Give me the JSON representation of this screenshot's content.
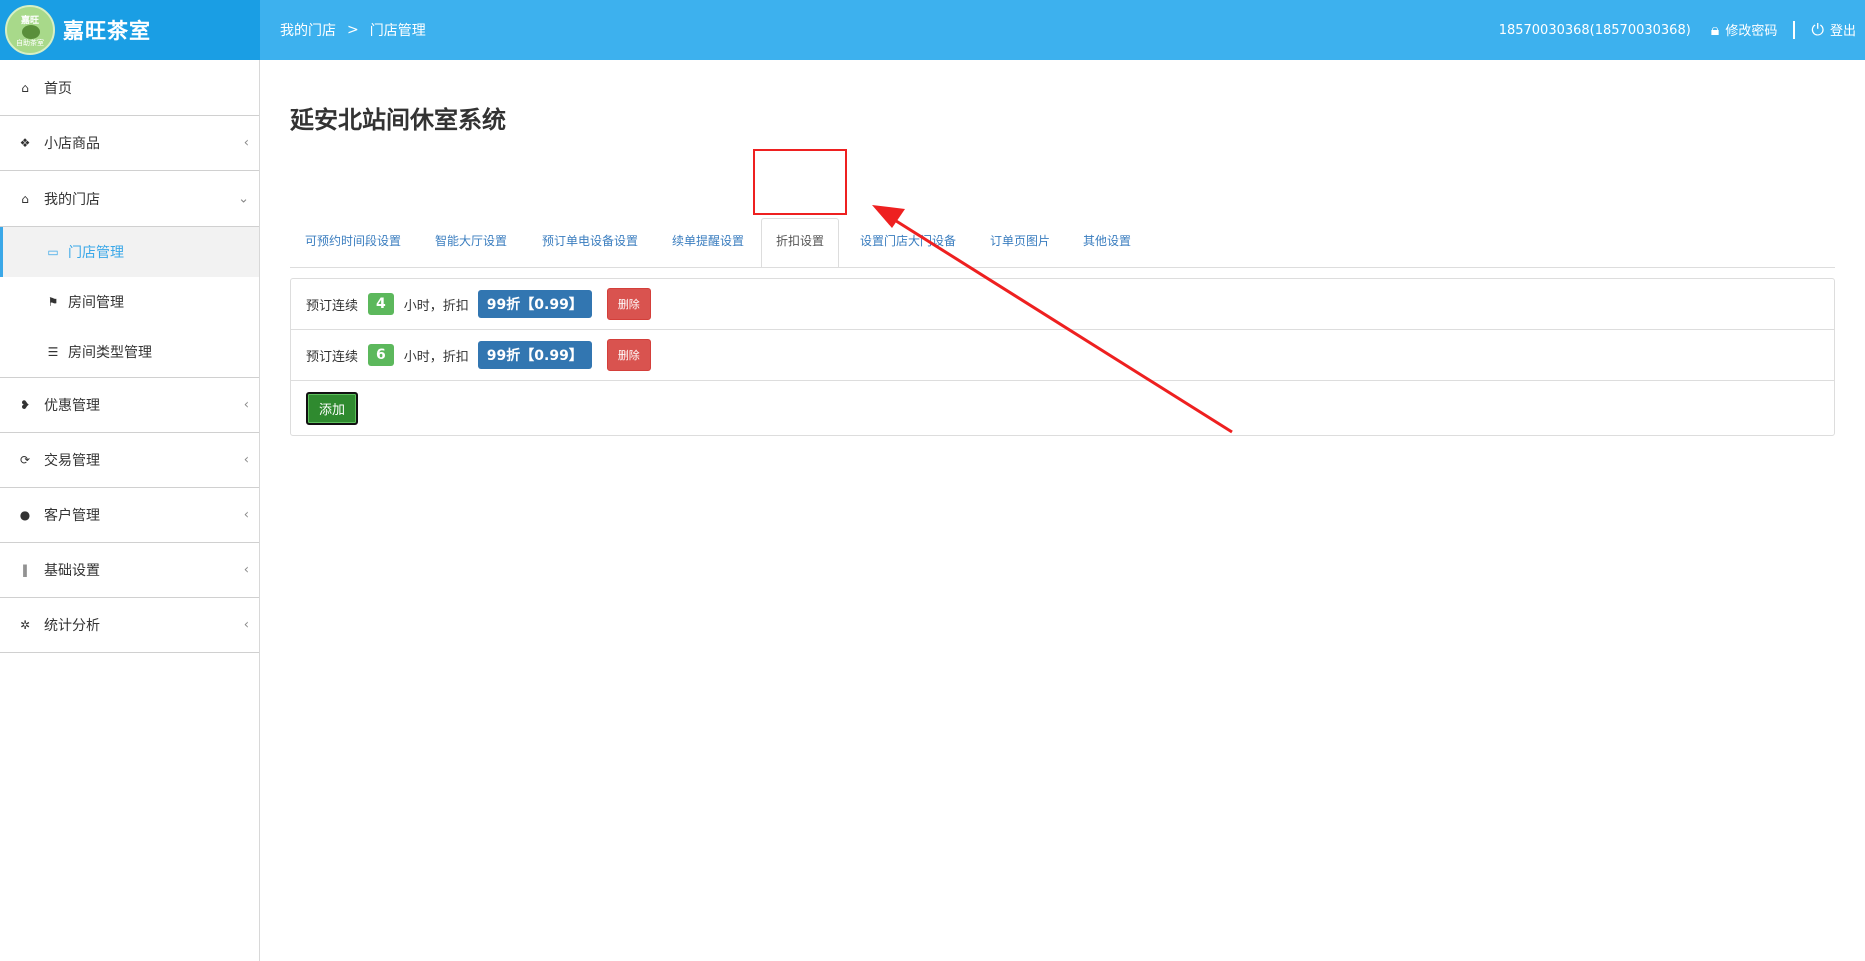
{
  "header": {
    "brand_name": "嘉旺茶室",
    "logo_text_top": "嘉旺",
    "logo_text_bottom": "自助茶室",
    "breadcrumb": [
      "我的门店",
      "门店管理"
    ],
    "breadcrumb_sep": ">",
    "user": "18570030368(18570030368)",
    "change_password": "修改密码",
    "logout": "登出",
    "colors": {
      "bar": "#3db1ee",
      "brand": "#1a9ee4"
    }
  },
  "sidebar": {
    "items": [
      {
        "label": "首页",
        "icon": "home-icon",
        "glyph": "⌂"
      },
      {
        "label": "小店商品",
        "icon": "gift-icon",
        "glyph": "❖",
        "chevron": "‹"
      },
      {
        "label": "我的门店",
        "icon": "home-icon",
        "glyph": "⌂",
        "chevron": "⌄"
      },
      {
        "label": "优惠管理",
        "icon": "tags-icon",
        "glyph": "❥",
        "chevron": "‹"
      },
      {
        "label": "交易管理",
        "icon": "refresh-icon",
        "glyph": "⟳",
        "chevron": "‹"
      },
      {
        "label": "客户管理",
        "icon": "user-icon",
        "glyph": "●",
        "chevron": "‹"
      },
      {
        "label": "基础设置",
        "icon": "barcode-icon",
        "glyph": "‖",
        "chevron": "‹"
      },
      {
        "label": "统计分析",
        "icon": "gear-icon",
        "glyph": "✲",
        "chevron": "‹"
      }
    ],
    "sub_items": [
      {
        "label": "门店管理",
        "icon": "inbox-icon",
        "glyph": "▭",
        "active": true
      },
      {
        "label": "房间管理",
        "icon": "flag-icon",
        "glyph": "⚑"
      },
      {
        "label": "房间类型管理",
        "icon": "list-icon",
        "glyph": "☰"
      }
    ]
  },
  "main": {
    "title": "延安北站间休室系统",
    "tabs": [
      {
        "label": "可预约时间段设置"
      },
      {
        "label": "智能大厅设置"
      },
      {
        "label": "预订单电设备设置"
      },
      {
        "label": "续单提醒设置"
      },
      {
        "label": "折扣设置",
        "active": true
      },
      {
        "label": "设置门店大门设备"
      },
      {
        "label": "订单页图片"
      },
      {
        "label": "其他设置"
      }
    ],
    "rows": [
      {
        "prefix": "预订连续",
        "hours": "4",
        "middle": "小时，折扣",
        "discount": "99折【0.99】",
        "delete_label": "删除"
      },
      {
        "prefix": "预订连续",
        "hours": "6",
        "middle": "小时，折扣",
        "discount": "99折【0.99】",
        "delete_label": "删除"
      }
    ],
    "add_label": "添加"
  }
}
